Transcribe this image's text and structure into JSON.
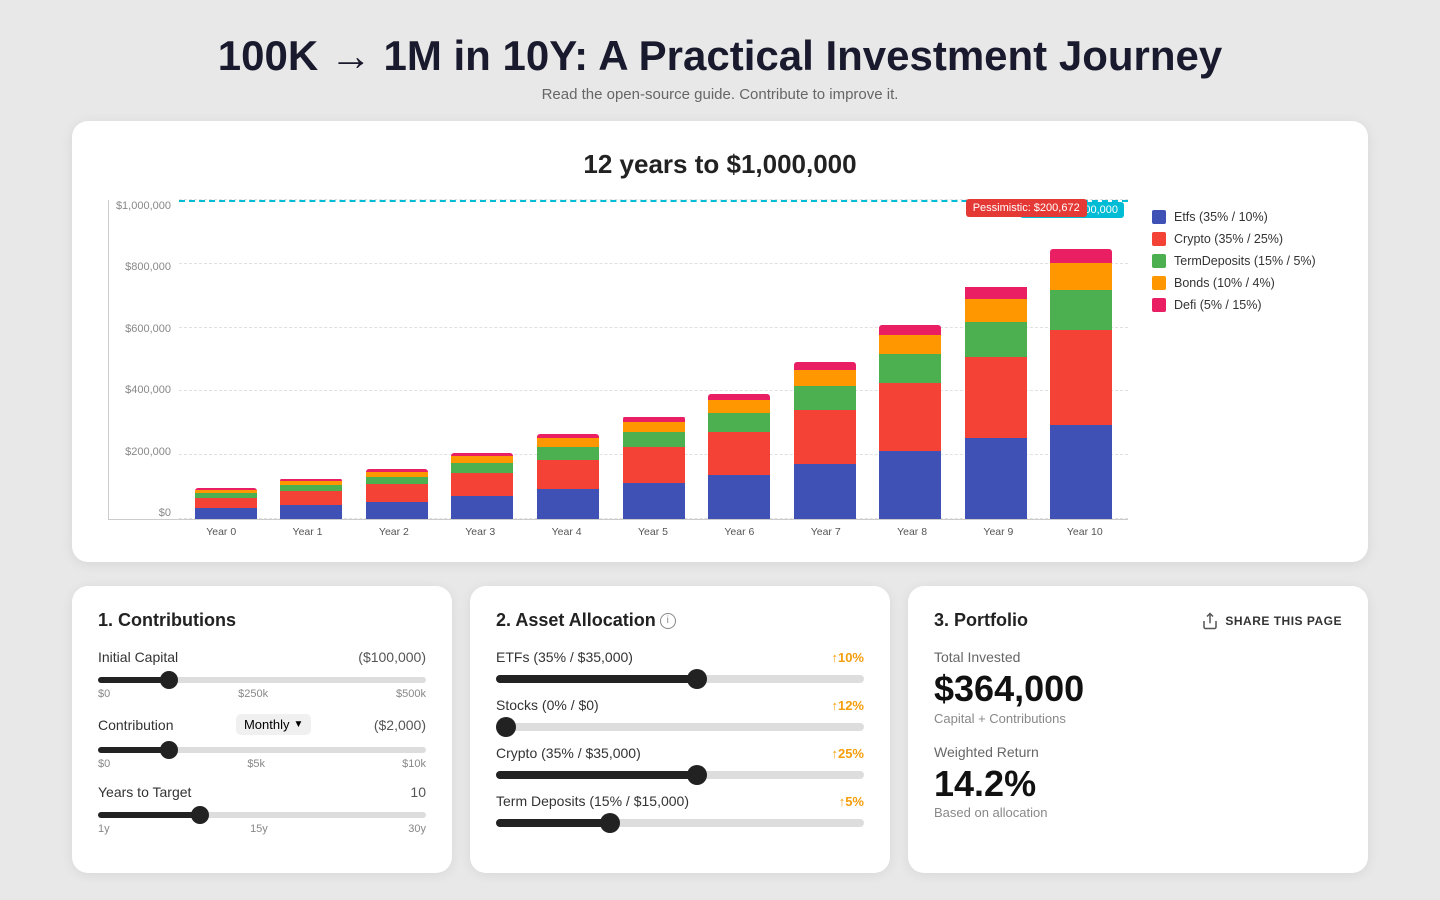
{
  "page": {
    "title": "100K → 1M in 10Y: A Practical Investment Journey",
    "subtitle": "Read the open-source guide. Contribute to improve it."
  },
  "chart": {
    "title": "12 years to $1,000,000",
    "target_label": "Target: $1,000,000",
    "pessimistic_label": "Pessimistic: $200,672",
    "y_labels": [
      "$0",
      "$200,000",
      "$400,000",
      "$600,000",
      "$800,000",
      "$1,000,000"
    ],
    "x_labels": [
      "Year 0",
      "Year 1",
      "Year 2",
      "Year 3",
      "Year 4",
      "Year 5",
      "Year 6",
      "Year 7",
      "Year 8",
      "Year 9",
      "Year 10"
    ],
    "legend": [
      {
        "label": "Etfs (35% / 10%)",
        "color": "#3f51b5"
      },
      {
        "label": "Crypto (35% / 25%)",
        "color": "#f44336"
      },
      {
        "label": "TermDeposits (15% / 5%)",
        "color": "#4caf50"
      },
      {
        "label": "Bonds (10% / 4%)",
        "color": "#ff9800"
      },
      {
        "label": "Defi (5% / 15%)",
        "color": "#e91e63"
      }
    ],
    "bars": [
      {
        "total_pct": 10,
        "segments": [
          35,
          35,
          15,
          10,
          5
        ]
      },
      {
        "total_pct": 13,
        "segments": [
          35,
          35,
          15,
          10,
          5
        ]
      },
      {
        "total_pct": 16,
        "segments": [
          35,
          35,
          15,
          10,
          5
        ]
      },
      {
        "total_pct": 21,
        "segments": [
          35,
          35,
          15,
          10,
          5
        ]
      },
      {
        "total_pct": 27,
        "segments": [
          35,
          35,
          15,
          10,
          5
        ]
      },
      {
        "total_pct": 33,
        "segments": [
          35,
          35,
          15,
          10,
          5
        ]
      },
      {
        "total_pct": 40,
        "segments": [
          35,
          35,
          15,
          10,
          5
        ]
      },
      {
        "total_pct": 50,
        "segments": [
          35,
          35,
          15,
          10,
          5
        ]
      },
      {
        "total_pct": 62,
        "segments": [
          35,
          35,
          15,
          10,
          5
        ]
      },
      {
        "total_pct": 74,
        "segments": [
          35,
          35,
          15,
          10,
          5
        ]
      },
      {
        "total_pct": 86,
        "segments": [
          35,
          35,
          15,
          10,
          5
        ]
      }
    ]
  },
  "contributions": {
    "heading": "1. Contributions",
    "initial_capital_label": "Initial Capital",
    "initial_capital_value": "($100,000)",
    "initial_capital_slider_pct": 20,
    "initial_capital_min": "$0",
    "initial_capital_mid": "$250k",
    "initial_capital_max": "$500k",
    "contribution_label": "Contribution",
    "contribution_dropdown": "Monthly",
    "contribution_value": "($2,000)",
    "contribution_slider_pct": 20,
    "contribution_min": "$0",
    "contribution_mid": "$5k",
    "contribution_max": "$10k",
    "years_label": "Years to Target",
    "years_value": "10",
    "years_slider_pct": 30,
    "years_min": "1y",
    "years_mid": "15y",
    "years_max": "30y"
  },
  "allocation": {
    "heading": "2. Asset Allocation",
    "info": true,
    "items": [
      {
        "label": "ETFs (35% / $35,000)",
        "rate": "↑10%",
        "slider_pct": 55,
        "color": "#3f51b5"
      },
      {
        "label": "Stocks (0% / $0)",
        "rate": "↑12%",
        "slider_pct": 0,
        "color": "#3f51b5"
      },
      {
        "label": "Crypto (35% / $35,000)",
        "rate": "↑25%",
        "slider_pct": 55,
        "color": "#3f51b5"
      },
      {
        "label": "Term Deposits (15% / $15,000)",
        "rate": "↑5%",
        "slider_pct": 30,
        "color": "#3f51b5"
      }
    ]
  },
  "portfolio": {
    "heading": "3. Portfolio",
    "share_label": "SHARE THIS PAGE",
    "total_invested_label": "Total Invested",
    "total_invested_value": "$364,000",
    "total_invested_sub": "Capital + Contributions",
    "weighted_return_label": "Weighted Return",
    "weighted_return_value": "14.2%",
    "weighted_return_sub": "Based on allocation"
  }
}
